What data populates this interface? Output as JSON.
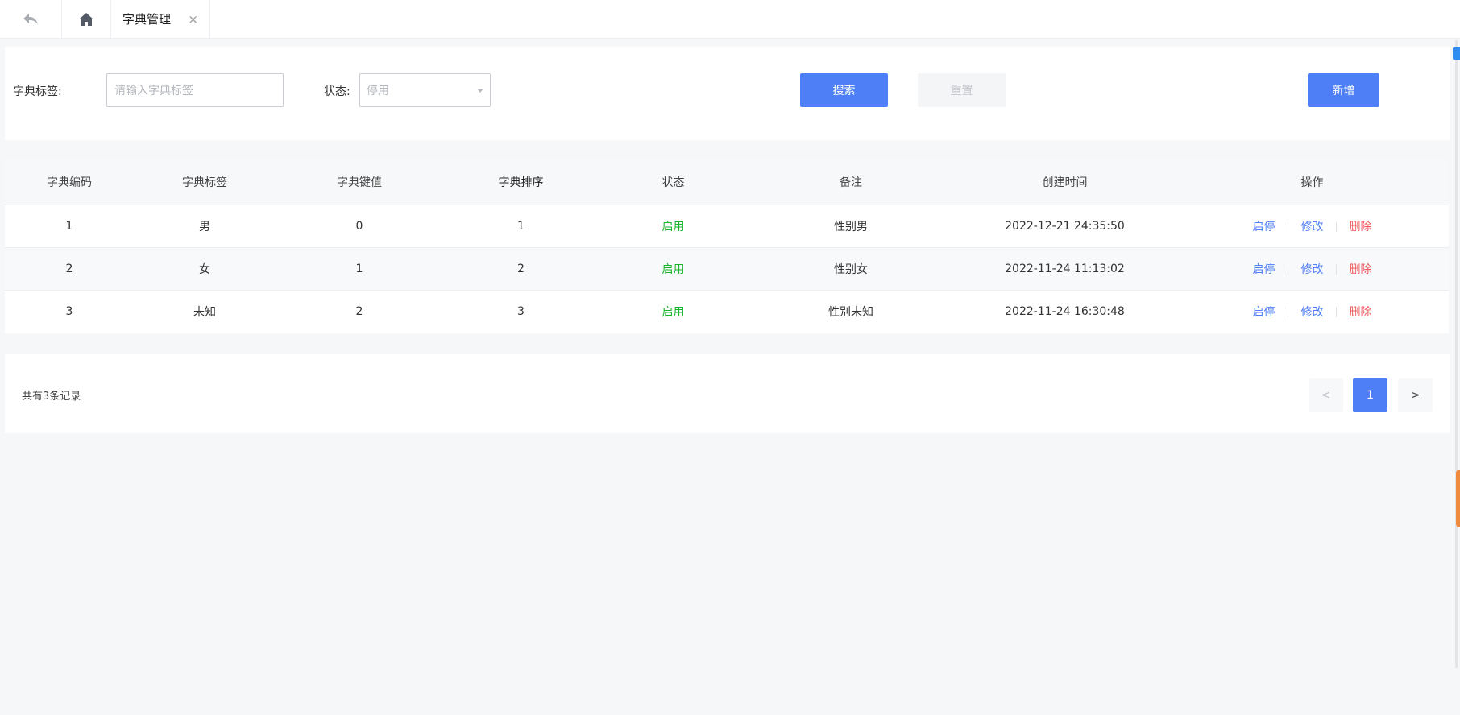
{
  "tabs": {
    "back_icon": "back-arrow-icon",
    "home_icon": "home-icon",
    "active_label": "字典管理",
    "close_glyph": "×"
  },
  "search": {
    "label_label": "字典标签:",
    "label_placeholder": "请输入字典标签",
    "label_value": "",
    "status_label": "状态:",
    "status_selected": "停用",
    "search_button": "搜索",
    "reset_button": "重置",
    "add_button": "新增"
  },
  "table": {
    "headers": [
      "字典编码",
      "字典标签",
      "字典键值",
      "字典排序",
      "状态",
      "备注",
      "创建时间",
      "操作"
    ],
    "rows": [
      {
        "code": "1",
        "label": "男",
        "key": "0",
        "sort": "1",
        "status": "启用",
        "remark": "性别男",
        "created": "2022-12-21 24:35:50"
      },
      {
        "code": "2",
        "label": "女",
        "key": "1",
        "sort": "2",
        "status": "启用",
        "remark": "性别女",
        "created": "2022-11-24 11:13:02"
      },
      {
        "code": "3",
        "label": "未知",
        "key": "2",
        "sort": "3",
        "status": "启用",
        "remark": "性别未知",
        "created": "2022-11-24 16:30:48"
      }
    ],
    "ops": {
      "toggle": "启停",
      "edit": "修改",
      "delete": "删除",
      "separator": "|"
    }
  },
  "pagination": {
    "total_text": "共有3条记录",
    "prev": "<",
    "current": "1",
    "next": ">"
  },
  "colors": {
    "primary": "#4f7ff7",
    "success": "#17b32c",
    "danger": "#f0565b"
  }
}
